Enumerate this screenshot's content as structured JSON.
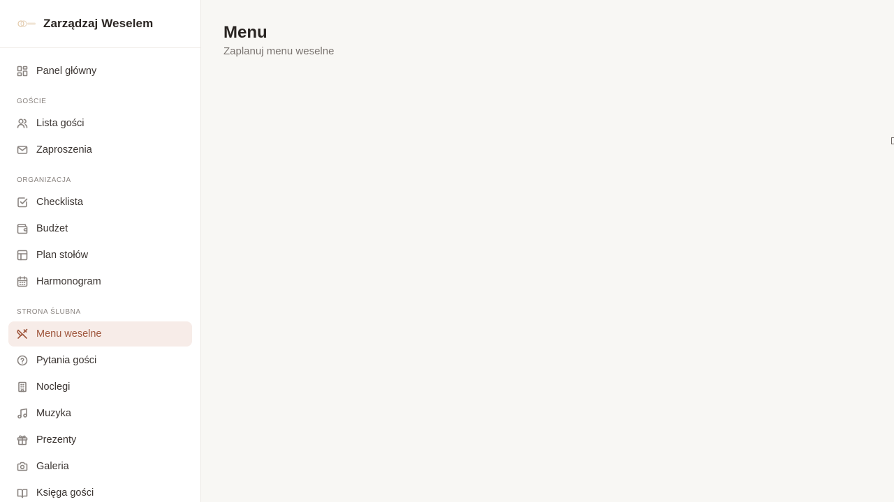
{
  "brand": {
    "title": "Zarządzaj Weselem",
    "logo_icon": "rings-logo-icon"
  },
  "sidebar": {
    "top_items": [
      {
        "label": "Panel główny",
        "icon": "dashboard-icon"
      }
    ],
    "sections": [
      {
        "label": "GOŚCIE",
        "items": [
          {
            "label": "Lista gości",
            "icon": "users-icon"
          },
          {
            "label": "Zaproszenia",
            "icon": "mail-icon"
          }
        ]
      },
      {
        "label": "ORGANIZACJA",
        "items": [
          {
            "label": "Checklista",
            "icon": "checkbox-icon"
          },
          {
            "label": "Budżet",
            "icon": "wallet-icon"
          },
          {
            "label": "Plan stołów",
            "icon": "table-layout-icon"
          },
          {
            "label": "Harmonogram",
            "icon": "calendar-icon"
          }
        ]
      },
      {
        "label": "STRONA ŚLUBNA",
        "items": [
          {
            "label": "Menu weselne",
            "icon": "utensils-crossed-icon",
            "active": true
          },
          {
            "label": "Pytania gości",
            "icon": "help-circle-icon"
          },
          {
            "label": "Noclegi",
            "icon": "building-icon"
          },
          {
            "label": "Muzyka",
            "icon": "music-icon"
          },
          {
            "label": "Prezenty",
            "icon": "gift-icon"
          },
          {
            "label": "Galeria",
            "icon": "camera-icon"
          },
          {
            "label": "Księga gości",
            "icon": "book-icon"
          }
        ]
      }
    ]
  },
  "main": {
    "title": "Menu",
    "subtitle": "Zaplanuj menu weselne"
  },
  "colors": {
    "accent": "#a0583f",
    "active_bg": "#f7ece8",
    "page_bg": "#f8f7f4",
    "sidebar_bg": "#ffffff"
  }
}
